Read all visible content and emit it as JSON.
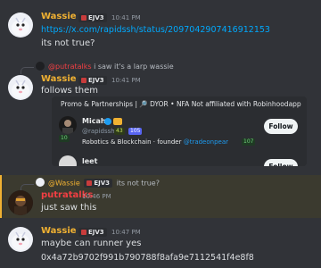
{
  "messages": [
    {
      "user": "Wassie",
      "tag": "EJV3",
      "time": "10:41 PM",
      "link": "https://x.com/rapidssh/status/2097042907416912153",
      "text": "its not true?"
    },
    {
      "reply_user": "@putratalks",
      "reply_text": "i saw it's a larp wassie",
      "user": "Wassie",
      "tag": "EJV3",
      "time": "10:41 PM",
      "text": "follows them",
      "embed": {
        "promo": "Promo & Partnerships | 🔎 DYOR • NFA Not affiliated with Robinhoodapp",
        "card1": {
          "name": "Micah",
          "handle": "@rapidssh",
          "badge_a": "43",
          "badge_b": "105",
          "badge_c": "10",
          "bio_prefix": "Robotics & Blockchain · founder ",
          "bio_mention": "@tradeonpear",
          "bio_badge": "107",
          "follow": "Follow"
        },
        "card2": {
          "name": "leet",
          "follow": "Follow"
        }
      }
    },
    {
      "reply_user": "@Wassie",
      "reply_tag": "EJV3",
      "reply_text": "its not true?",
      "user": "putratalks",
      "time": "10:46 PM",
      "text": "just saw this"
    },
    {
      "user": "Wassie",
      "tag": "EJV3",
      "time": "10:47 PM",
      "text": "maybe can runner yes",
      "text2": "0x4a72b9702f991b790788f8afa9e7112541f4e8f8"
    }
  ],
  "colors": {
    "background": "#313338",
    "username_wassie": "#f0b132",
    "username_putratalks": "#f23f43",
    "link": "#00a8fc",
    "highlight": "#3b3a2f"
  }
}
